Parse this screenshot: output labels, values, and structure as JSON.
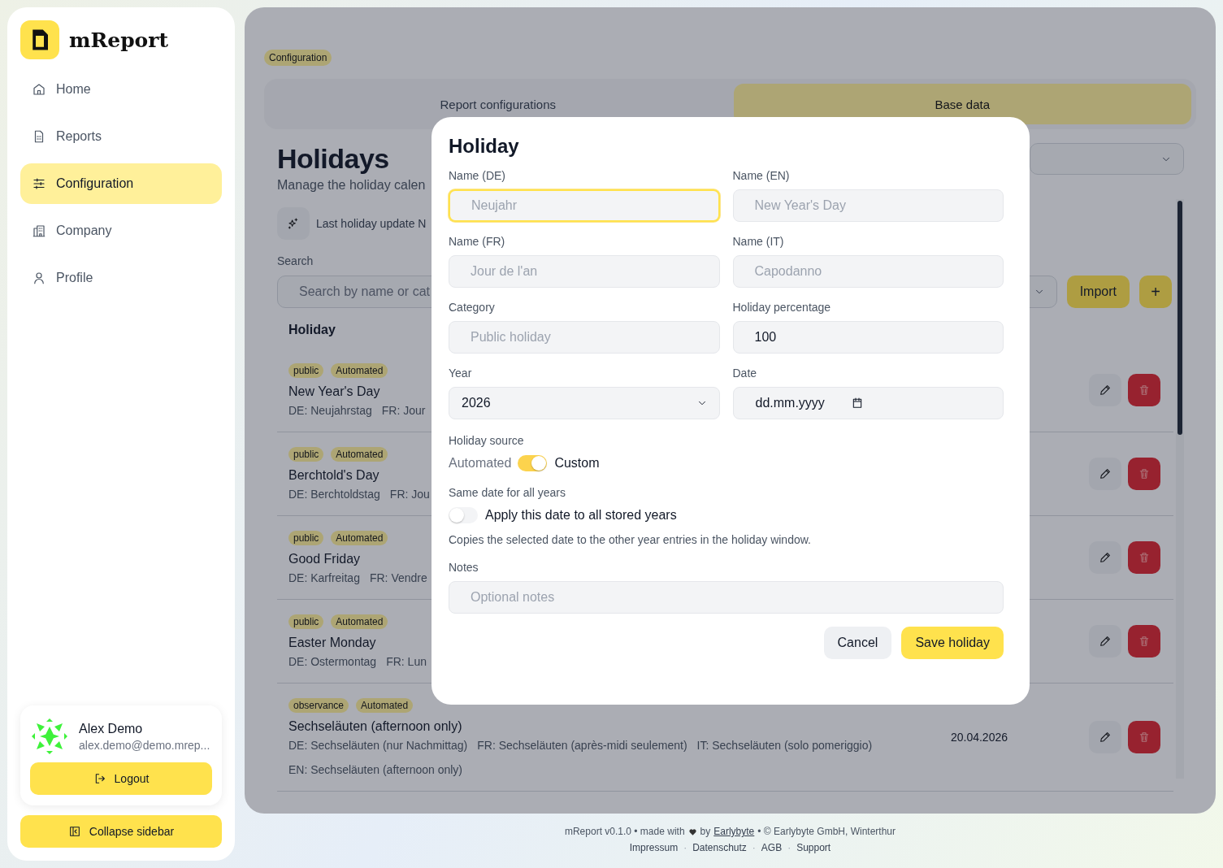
{
  "sidebar": {
    "brand": "mReport",
    "nav": [
      {
        "label": "Home",
        "selected": false
      },
      {
        "label": "Reports",
        "selected": false
      },
      {
        "label": "Configuration",
        "selected": true
      },
      {
        "label": "Company",
        "selected": false
      },
      {
        "label": "Profile",
        "selected": false
      }
    ],
    "user": {
      "name": "Alex Demo",
      "email": "alex.demo@demo.mrep..."
    },
    "logout": "Logout",
    "collapse": "Collapse sidebar"
  },
  "main": {
    "breadcrumb": "Configuration",
    "tabs": [
      {
        "label": "Report configurations",
        "selected": false
      },
      {
        "label": "Base data",
        "selected": true
      }
    ],
    "title": "Holidays",
    "subtitle": "Manage the holiday calen",
    "update_note": "Last holiday update N",
    "search": {
      "label": "Search",
      "placeholder": "Search by name or cat"
    },
    "import_button": "Import",
    "add_button": "+",
    "list_header": "Holiday",
    "rows": [
      {
        "tags": [
          "public",
          "Automated"
        ],
        "title": "New Year's Day",
        "lines": [
          [
            "DE: Neujahrstag",
            "FR: Jour"
          ]
        ]
      },
      {
        "tags": [
          "public",
          "Automated"
        ],
        "title": "Berchtold's Day",
        "lines": [
          [
            "DE: Berchtoldstag",
            "FR: Jou"
          ]
        ]
      },
      {
        "tags": [
          "public",
          "Automated"
        ],
        "title": "Good Friday",
        "lines": [
          [
            "DE: Karfreitag",
            "FR: Vendre"
          ]
        ]
      },
      {
        "tags": [
          "public",
          "Automated"
        ],
        "title": "Easter Monday",
        "lines": [
          [
            "DE: Ostermontag",
            "FR: Lun"
          ]
        ]
      },
      {
        "tags": [
          "observance",
          "Automated"
        ],
        "title": "Sechseläuten (afternoon only)",
        "lines": [
          [
            "DE: Sechseläuten (nur Nachmittag)",
            "FR: Sechseläuten (après-midi seulement)",
            "IT: Sechseläuten (solo pomeriggio)"
          ],
          [
            "EN: Sechseläuten (afternoon only)"
          ]
        ],
        "date": "20.04.2026"
      }
    ]
  },
  "dialog": {
    "title": "Holiday",
    "fields": [
      {
        "label": "Name (DE)",
        "kind": "text",
        "placeholder": "Neujahr",
        "focused": true
      },
      {
        "label": "Name (EN)",
        "kind": "text",
        "placeholder": "New Year's Day",
        "focused": false
      },
      {
        "label": "Name (FR)",
        "kind": "text",
        "placeholder": "Jour de l'an",
        "focused": false
      },
      {
        "label": "Name (IT)",
        "kind": "text",
        "placeholder": "Capodanno",
        "focused": false
      },
      {
        "label": "Category",
        "kind": "text",
        "placeholder": "Public holiday",
        "focused": false
      },
      {
        "label": "Holiday percentage",
        "kind": "text",
        "value": "100",
        "focused": false
      },
      {
        "label": "Year",
        "kind": "select",
        "value": "2026",
        "focused": false
      },
      {
        "label": "Date",
        "kind": "date",
        "value": "dd.mm.yyyy",
        "focused": false
      }
    ],
    "source": {
      "label": "Holiday source",
      "off_label": "Automated",
      "on_label": "Custom",
      "on": true
    },
    "same_date": {
      "label": "Same date for all years",
      "text": "Apply this date to all stored years",
      "on": false,
      "help": "Copies the selected date to the other year entries in the holiday window."
    },
    "notes": {
      "label": "Notes",
      "placeholder": "Optional notes"
    },
    "buttons": [
      {
        "label": "Cancel",
        "kind": "secondary"
      },
      {
        "label": "Save holiday",
        "kind": "primary"
      }
    ]
  },
  "footer": {
    "credit_before": "mReport v0.1.0 • made with",
    "credit_by": "by",
    "credit_link": "Earlybyte",
    "credit_after": "• © Earlybyte GmbH, Winterthur",
    "separator": "·",
    "links": [
      "Impressum",
      "Datenschutz",
      "AGB",
      "Support"
    ]
  }
}
